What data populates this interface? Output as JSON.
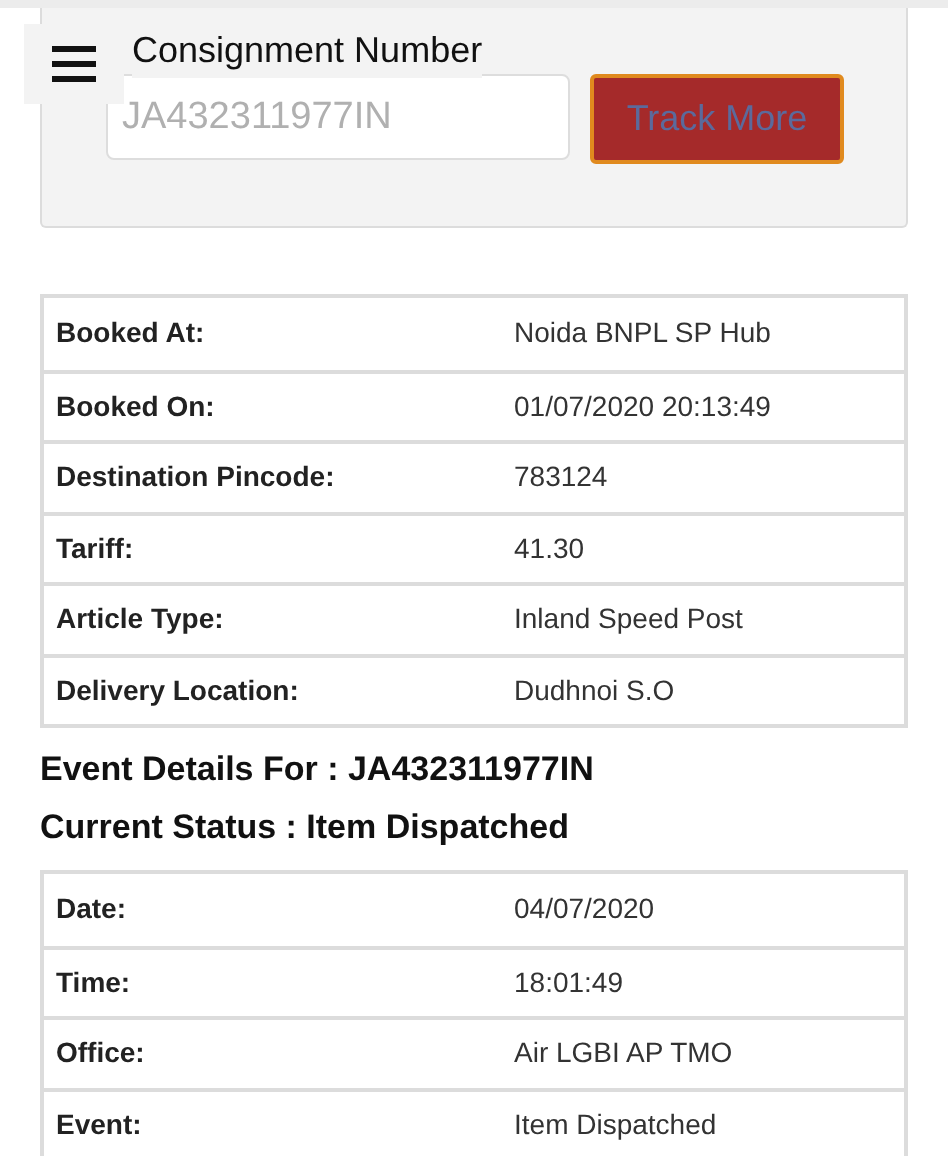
{
  "form": {
    "label": "Consignment Number",
    "input": {
      "placeholder": "JA432311977IN"
    },
    "button": "Track More"
  },
  "booking_details": [
    {
      "label": "Booked At:",
      "value": "Noida BNPL SP Hub"
    },
    {
      "label": "Booked On:",
      "value": "01/07/2020 20:13:49"
    },
    {
      "label": "Destination Pincode:",
      "value": "783124"
    },
    {
      "label": "Tariff:",
      "value": "41.30"
    },
    {
      "label": "Article Type:",
      "value": "Inland Speed Post"
    },
    {
      "label": "Delivery Location:",
      "value": "Dudhnoi S.O"
    }
  ],
  "event_heading": "Event Details For : JA432311977IN",
  "status_heading": "Current Status : Item Dispatched",
  "event_details": [
    {
      "label": "Date:",
      "value": "04/07/2020"
    },
    {
      "label": "Time:",
      "value": "18:01:49"
    },
    {
      "label": "Office:",
      "value": "Air LGBI AP TMO"
    },
    {
      "label": "Event:",
      "value": "Item Dispatched"
    }
  ]
}
